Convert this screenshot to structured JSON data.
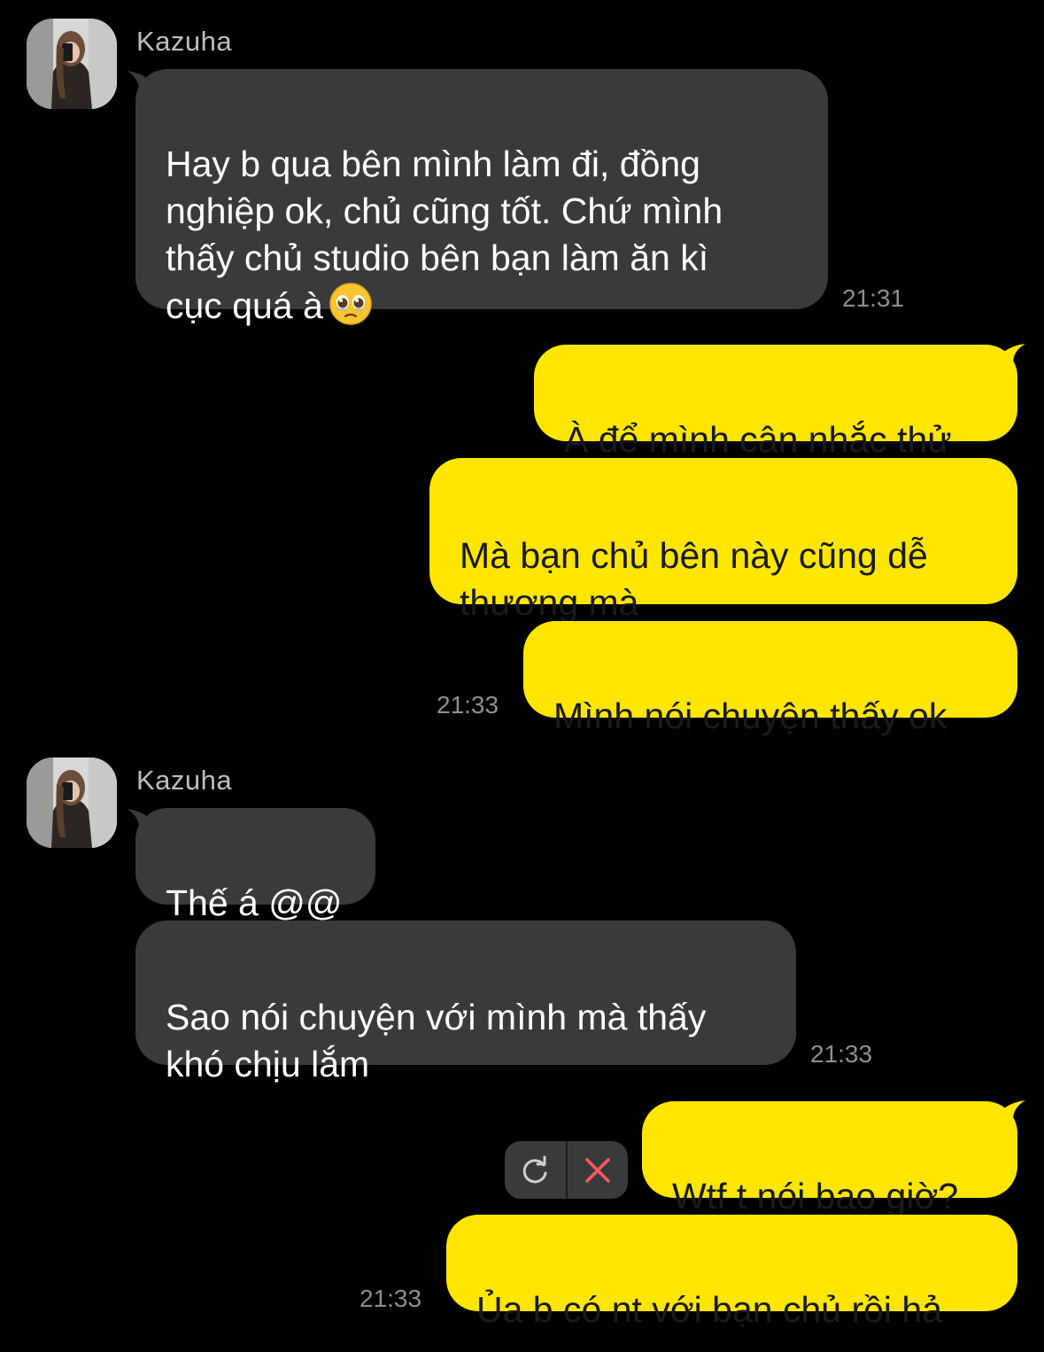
{
  "colors": {
    "background": "#000000",
    "incoming_bubble": "#3a3a3c",
    "outgoing_bubble": "#ffe600",
    "timestamp": "#8e8e8e",
    "cancel_icon": "#ff5b5b"
  },
  "group1": {
    "sender": "Kazuha",
    "messages": [
      {
        "text": "Hay b qua bên mình làm đi, đồng\nnghiệp ok, chủ cũng tốt. Chứ mình\nthấy chủ studio bên bạn làm ăn kì\ncục quá à",
        "emoji": "pleading-face"
      }
    ],
    "time": "21:31"
  },
  "group2": {
    "messages": [
      {
        "text": "À để mình cân nhắc thử"
      },
      {
        "text": "Mà bạn chủ bên này cũng dễ\nthương mà"
      },
      {
        "text": "Mình nói chuyện thấy ok"
      }
    ],
    "time": "21:33"
  },
  "group3": {
    "sender": "Kazuha",
    "messages": [
      {
        "text": "Thế á @@"
      },
      {
        "text": "Sao nói chuyện với mình mà thấy\nkhó chịu lắm"
      }
    ],
    "time": "21:33"
  },
  "group4": {
    "messages": [
      {
        "text": "Wtf t nói bao giờ?",
        "failed": true
      },
      {
        "text": "Ủa b có nt với bạn chủ rồi hả"
      }
    ],
    "time": "21:33"
  },
  "icons": {
    "retry": "retry-icon",
    "cancel": "close-icon"
  }
}
